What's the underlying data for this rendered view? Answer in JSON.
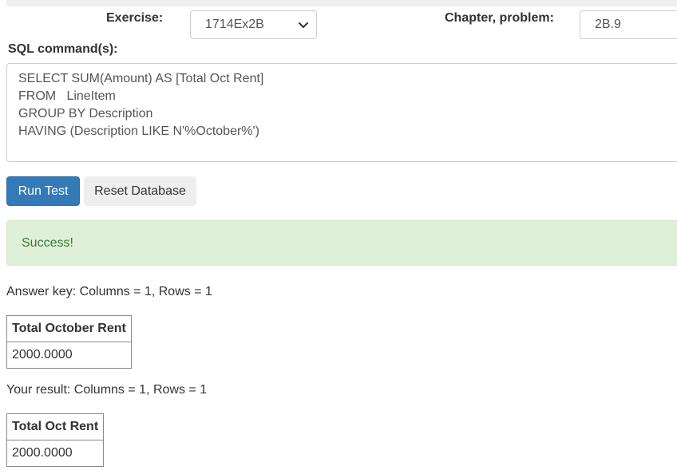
{
  "form": {
    "exercise_label": "Exercise:",
    "exercise_selected": "1714Ex2B",
    "chapter_label": "Chapter, problem:",
    "chapter_value": "2B.9",
    "sql_label": "SQL command(s):",
    "sql_text": "SELECT SUM(Amount) AS [Total Oct Rent]\nFROM   LineItem\nGROUP BY Description\nHAVING (Description LIKE N'%October%')"
  },
  "buttons": {
    "run_label": "Run Test",
    "reset_label": "Reset Database"
  },
  "colors": {
    "primary": "#337ab7",
    "success_bg": "#dff0d8",
    "success_text": "#3c763d"
  },
  "alert": {
    "message": "Success!"
  },
  "answer_key": {
    "summary": "Answer key: Columns = 1, Rows = 1",
    "header": "Total October Rent",
    "value": "2000.0000"
  },
  "your_result": {
    "summary": "Your result: Columns = 1, Rows = 1",
    "header": "Total Oct Rent",
    "value": "2000.0000"
  }
}
